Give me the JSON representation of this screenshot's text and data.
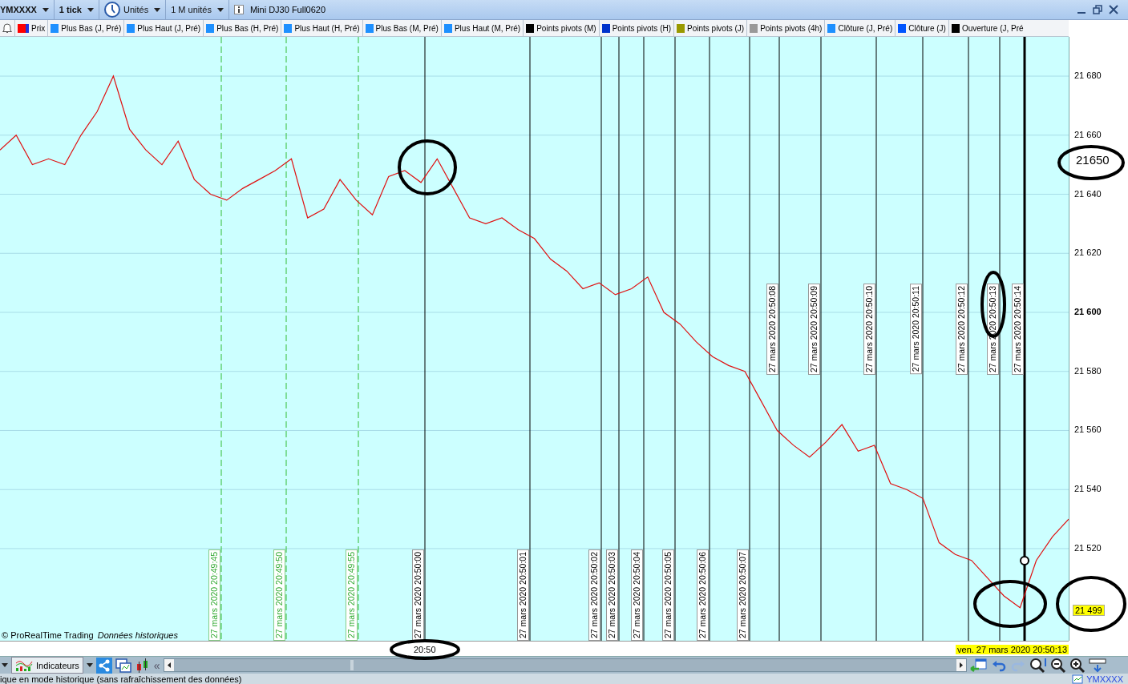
{
  "toolbar": {
    "symbol": "YMXXXX",
    "interval": "1 tick",
    "units_label": "Unités",
    "units": "1 M unités",
    "instrument": "Mini DJ30 Full0620"
  },
  "legend": [
    {
      "label": "Prix",
      "color": "#ff0000"
    },
    {
      "label": "Plus Bas (J, Pré)",
      "color": "#1e90ff"
    },
    {
      "label": "Plus Haut (J, Pré)",
      "color": "#1e90ff"
    },
    {
      "label": "Plus Bas (H, Pré)",
      "color": "#1e90ff"
    },
    {
      "label": "Plus Haut (H, Pré)",
      "color": "#1e90ff"
    },
    {
      "label": "Plus Bas (M, Pré)",
      "color": "#1e90ff"
    },
    {
      "label": "Plus Haut (M, Pré)",
      "color": "#1e90ff"
    },
    {
      "label": "Points pivots (M)",
      "color": "#000000"
    },
    {
      "label": "Points pivots (H)",
      "color": "#0033cc"
    },
    {
      "label": "Points pivots (J)",
      "color": "#999900"
    },
    {
      "label": "Points pivots (4h)",
      "color": "#999999"
    },
    {
      "label": "Clôture (J, Pré)",
      "color": "#1e90ff"
    },
    {
      "label": "Clôture (J)",
      "color": "#0055ff"
    },
    {
      "label": "Ouverture (J, Pré",
      "color": "#000000"
    }
  ],
  "chart": {
    "chart_data": {
      "type": "line",
      "ylim": [
        21488.8,
        21693.3
      ],
      "grid": true,
      "yticks": [
        {
          "value": 21680,
          "label": "21 680"
        },
        {
          "value": 21660,
          "label": "21 660"
        },
        {
          "value": 21640,
          "label": "21 640"
        },
        {
          "value": 21620,
          "label": "21 620"
        },
        {
          "value": 21600,
          "label": "21 600"
        },
        {
          "value": 21580,
          "label": "21 580"
        },
        {
          "value": 21560,
          "label": "21 560"
        },
        {
          "value": 21540,
          "label": "21 540"
        },
        {
          "value": 21520,
          "label": "21 520"
        }
      ],
      "series": [
        {
          "color": "#e01010",
          "values": [
            21655,
            21660,
            21650,
            21652,
            21650,
            21660,
            21668,
            21680,
            21662,
            21655,
            21650,
            21658,
            21645,
            21640,
            21638,
            21642,
            21645,
            21648,
            21652,
            21632,
            21635,
            21645,
            21638,
            21633,
            21646,
            21648,
            21644,
            21652,
            21642,
            21632,
            21630,
            21632,
            21628,
            21625,
            21618,
            21614,
            21608,
            21610,
            21606,
            21608,
            21612,
            21600,
            21596,
            21590,
            21585,
            21582,
            21580,
            21570,
            21560,
            21555,
            21551,
            21556,
            21562,
            21553,
            21555,
            21542,
            21540,
            21537,
            21522,
            21518,
            21516,
            21510,
            21504,
            21500,
            21516,
            21524,
            21530
          ]
        }
      ]
    },
    "y_axis_styles": [
      {
        "bold": false
      },
      {
        "bold": false
      },
      {
        "bold": false
      },
      {
        "bold": false
      },
      {
        "bold": true
      },
      {
        "bold": false
      },
      {
        "bold": false
      },
      {
        "bold": false
      },
      {
        "bold": false
      }
    ],
    "markers": [
      {
        "label": "27 mars 2020 20:49:45",
        "kind": "dashed"
      },
      {
        "label": "27 mars 2020 20:49:50",
        "kind": "dashed"
      },
      {
        "label": "27 mars 2020 20:49:55",
        "kind": "dashed"
      },
      {
        "label": "27 mars 2020 20:50:00",
        "kind": "solid"
      },
      {
        "label": "27 mars 2020 20:50:01",
        "kind": "solid"
      },
      {
        "label": "27 mars 2020 20:50:02",
        "kind": "solid"
      },
      {
        "label": "27 mars 2020 20:50:03",
        "kind": "solid"
      },
      {
        "label": "27 mars 2020 20:50:04",
        "kind": "solid"
      },
      {
        "label": "27 mars 2020 20:50:05",
        "kind": "solid"
      },
      {
        "label": "27 mars 2020 20:50:06",
        "kind": "solid"
      },
      {
        "label": "27 mars 2020 20:50:07",
        "kind": "solid"
      },
      {
        "label": "27 mars 2020 20:50:08",
        "kind": "solid"
      },
      {
        "label": "27 mars 2020 20:50:09",
        "kind": "solid"
      },
      {
        "label": "27 mars 2020 20:50:10",
        "kind": "solid"
      },
      {
        "label": "27 mars 2020 20:50:11",
        "kind": "solid"
      },
      {
        "label": "27 mars 2020 20:50:12",
        "kind": "solid"
      },
      {
        "label": "27 mars 2020 20:50:13",
        "kind": "solid"
      },
      {
        "label": "27 mars 2020 20:50:14",
        "kind": "thick"
      }
    ],
    "copyright": "© ProRealTime Trading",
    "data_note": "Données historiques",
    "annotation_value": "21650",
    "price_tag": "21 499",
    "time_label": "20:50",
    "cursor_date": "ven. 27 mars 2020 20:50:13"
  },
  "bottom_toolbar": {
    "indicators": "Indicateurs",
    "collapse": "«"
  },
  "status_bar": {
    "message": "ique en mode historique (sans rafraîchissement des données)",
    "symbol": "YMXXXX"
  }
}
